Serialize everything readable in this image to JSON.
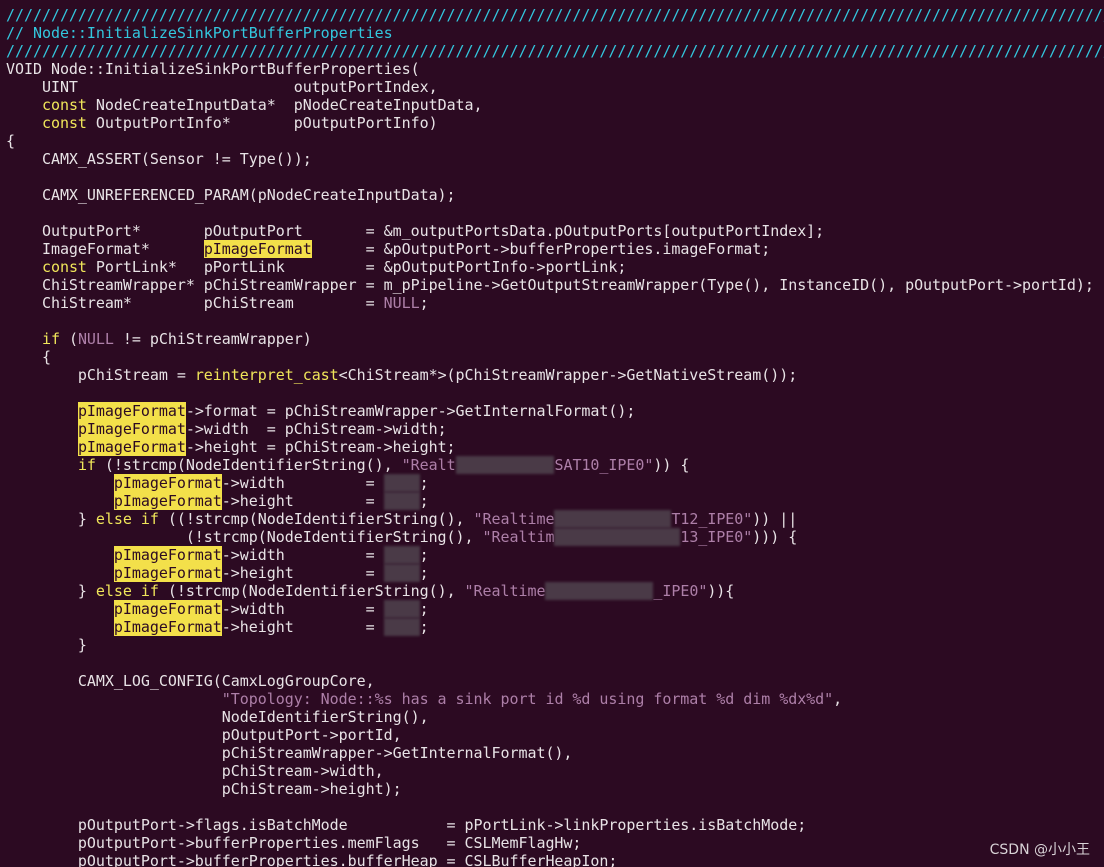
{
  "editor": {
    "background": "#2c0a22",
    "text_color": "#e8e3e6",
    "comment_color": "#33c7de",
    "keyword_color": "#f0e65a",
    "string_color": "#ad7fa8",
    "highlight_color": "#f3e04a",
    "redacted_color": "#4a3a47",
    "lines": [
      [
        {
          "t": "c",
          "v": "////////////////////////////////////////////////////////////////////////////////////////////////////////////////////////////////"
        }
      ],
      [
        {
          "t": "c",
          "v": "// Node::InitializeSinkPortBufferProperties"
        }
      ],
      [
        {
          "t": "c",
          "v": "////////////////////////////////////////////////////////////////////////////////////////////////////////////////////////////////"
        }
      ],
      [
        {
          "t": "p",
          "v": "VOID Node::InitializeSinkPortBufferProperties("
        }
      ],
      [
        {
          "t": "p",
          "v": "    UINT                        outputPortIndex,"
        }
      ],
      [
        {
          "t": "p",
          "v": "    "
        },
        {
          "t": "k",
          "v": "const"
        },
        {
          "t": "p",
          "v": " NodeCreateInputData*  pNodeCreateInputData,"
        }
      ],
      [
        {
          "t": "p",
          "v": "    "
        },
        {
          "t": "k",
          "v": "const"
        },
        {
          "t": "p",
          "v": " OutputPortInfo*       pOutputPortInfo)"
        }
      ],
      [
        {
          "t": "p",
          "v": "{"
        }
      ],
      [
        {
          "t": "p",
          "v": "    CAMX_ASSERT(Sensor != Type());"
        }
      ],
      [
        {
          "t": "p",
          "v": ""
        }
      ],
      [
        {
          "t": "p",
          "v": "    CAMX_UNREFERENCED_PARAM(pNodeCreateInputData);"
        }
      ],
      [
        {
          "t": "p",
          "v": ""
        }
      ],
      [
        {
          "t": "p",
          "v": "    OutputPort*       pOutputPort       = &m_outputPortsData.pOutputPorts[outputPortIndex];"
        }
      ],
      [
        {
          "t": "p",
          "v": "    ImageFormat*      "
        },
        {
          "t": "h",
          "v": "pImageFormat"
        },
        {
          "t": "p",
          "v": "      = &pOutputPort->bufferProperties.imageFormat;"
        }
      ],
      [
        {
          "t": "p",
          "v": "    "
        },
        {
          "t": "k",
          "v": "const"
        },
        {
          "t": "p",
          "v": " PortLink*   pPortLink         = &pOutputPortInfo->portLink;"
        }
      ],
      [
        {
          "t": "p",
          "v": "    ChiStreamWrapper* pChiStreamWrapper = m_pPipeline->GetOutputStreamWrapper(Type(), InstanceID(), pOutputPort->portId);"
        }
      ],
      [
        {
          "t": "p",
          "v": "    ChiStream*        pChiStream        = "
        },
        {
          "t": "n",
          "v": "NULL"
        },
        {
          "t": "p",
          "v": ";"
        }
      ],
      [
        {
          "t": "p",
          "v": ""
        }
      ],
      [
        {
          "t": "p",
          "v": "    "
        },
        {
          "t": "k",
          "v": "if"
        },
        {
          "t": "p",
          "v": " ("
        },
        {
          "t": "n",
          "v": "NULL"
        },
        {
          "t": "p",
          "v": " != pChiStreamWrapper)"
        }
      ],
      [
        {
          "t": "p",
          "v": "    {"
        }
      ],
      [
        {
          "t": "p",
          "v": "        pChiStream = "
        },
        {
          "t": "k",
          "v": "reinterpret_cast"
        },
        {
          "t": "p",
          "v": "<ChiStream*>(pChiStreamWrapper->GetNativeStream());"
        }
      ],
      [
        {
          "t": "p",
          "v": ""
        }
      ],
      [
        {
          "t": "p",
          "v": "        "
        },
        {
          "t": "h",
          "v": "pImageFormat"
        },
        {
          "t": "p",
          "v": "->format = pChiStreamWrapper->GetInternalFormat();"
        }
      ],
      [
        {
          "t": "p",
          "v": "        "
        },
        {
          "t": "h",
          "v": "pImageFormat"
        },
        {
          "t": "p",
          "v": "->width  = pChiStream->width;"
        }
      ],
      [
        {
          "t": "p",
          "v": "        "
        },
        {
          "t": "h",
          "v": "pImageFormat"
        },
        {
          "t": "p",
          "v": "->height = pChiStream->height;"
        }
      ],
      [
        {
          "t": "p",
          "v": "        "
        },
        {
          "t": "k",
          "v": "if"
        },
        {
          "t": "p",
          "v": " (!strcmp(NodeIdentifierString(), "
        },
        {
          "t": "s",
          "v": "\"Realt"
        },
        {
          "t": "r",
          "v": "           "
        },
        {
          "t": "s",
          "v": "SAT10_IPE0\""
        },
        {
          "t": "p",
          "v": ")) {"
        }
      ],
      [
        {
          "t": "p",
          "v": "            "
        },
        {
          "t": "h",
          "v": "pImageFormat"
        },
        {
          "t": "p",
          "v": "->width         = "
        },
        {
          "t": "r",
          "v": "    "
        },
        {
          "t": "p",
          "v": ";"
        }
      ],
      [
        {
          "t": "p",
          "v": "            "
        },
        {
          "t": "h",
          "v": "pImageFormat"
        },
        {
          "t": "p",
          "v": "->height        = "
        },
        {
          "t": "r",
          "v": "    "
        },
        {
          "t": "p",
          "v": ";"
        }
      ],
      [
        {
          "t": "p",
          "v": "        } "
        },
        {
          "t": "k",
          "v": "else if"
        },
        {
          "t": "p",
          "v": " ((!strcmp(NodeIdentifierString(), "
        },
        {
          "t": "s",
          "v": "\"Realtime"
        },
        {
          "t": "r",
          "v": "             "
        },
        {
          "t": "s",
          "v": "T12_IPE0\""
        },
        {
          "t": "p",
          "v": ")) ||"
        }
      ],
      [
        {
          "t": "p",
          "v": "                    (!strcmp(NodeIdentifierString(), "
        },
        {
          "t": "s",
          "v": "\"Realtim"
        },
        {
          "t": "r",
          "v": "              "
        },
        {
          "t": "s",
          "v": "13_IPE0\""
        },
        {
          "t": "p",
          "v": "))) {"
        }
      ],
      [
        {
          "t": "p",
          "v": "            "
        },
        {
          "t": "h",
          "v": "pImageFormat"
        },
        {
          "t": "p",
          "v": "->width         = "
        },
        {
          "t": "r",
          "v": "    "
        },
        {
          "t": "p",
          "v": ";"
        }
      ],
      [
        {
          "t": "p",
          "v": "            "
        },
        {
          "t": "h",
          "v": "pImageFormat"
        },
        {
          "t": "p",
          "v": "->height        = "
        },
        {
          "t": "r",
          "v": "    "
        },
        {
          "t": "p",
          "v": ";"
        }
      ],
      [
        {
          "t": "p",
          "v": "        } "
        },
        {
          "t": "k",
          "v": "else if"
        },
        {
          "t": "p",
          "v": " (!strcmp(NodeIdentifierString(), "
        },
        {
          "t": "s",
          "v": "\"Realtime"
        },
        {
          "t": "r",
          "v": "            "
        },
        {
          "t": "s",
          "v": "_IPE0\""
        },
        {
          "t": "p",
          "v": ")){"
        }
      ],
      [
        {
          "t": "p",
          "v": "            "
        },
        {
          "t": "h",
          "v": "pImageFormat"
        },
        {
          "t": "p",
          "v": "->width         = "
        },
        {
          "t": "r",
          "v": "    "
        },
        {
          "t": "p",
          "v": ";"
        }
      ],
      [
        {
          "t": "p",
          "v": "            "
        },
        {
          "t": "h",
          "v": "pImageFormat"
        },
        {
          "t": "p",
          "v": "->height        = "
        },
        {
          "t": "r",
          "v": "    "
        },
        {
          "t": "p",
          "v": ";"
        }
      ],
      [
        {
          "t": "p",
          "v": "        }"
        }
      ],
      [
        {
          "t": "p",
          "v": ""
        }
      ],
      [
        {
          "t": "p",
          "v": "        CAMX_LOG_CONFIG(CamxLogGroupCore,"
        }
      ],
      [
        {
          "t": "p",
          "v": "                        "
        },
        {
          "t": "s",
          "v": "\"Topology: Node::%s has a sink port id %d using format %d dim %dx%d\""
        },
        {
          "t": "p",
          "v": ","
        }
      ],
      [
        {
          "t": "p",
          "v": "                        NodeIdentifierString(),"
        }
      ],
      [
        {
          "t": "p",
          "v": "                        pOutputPort->portId,"
        }
      ],
      [
        {
          "t": "p",
          "v": "                        pChiStreamWrapper->GetInternalFormat(),"
        }
      ],
      [
        {
          "t": "p",
          "v": "                        pChiStream->width,"
        }
      ],
      [
        {
          "t": "p",
          "v": "                        pChiStream->height);"
        }
      ],
      [
        {
          "t": "p",
          "v": ""
        }
      ],
      [
        {
          "t": "p",
          "v": "        pOutputPort->flags.isBatchMode           = pPortLink->linkProperties.isBatchMode;"
        }
      ],
      [
        {
          "t": "p",
          "v": "        pOutputPort->bufferProperties.memFlags   = CSLMemFlagHw;"
        }
      ],
      [
        {
          "t": "p",
          "v": "        pOutputPort->bufferProperties.bufferHeap = CSLBufferHeapIon;"
        }
      ]
    ]
  },
  "watermark": {
    "text": "CSDN @小小王"
  }
}
